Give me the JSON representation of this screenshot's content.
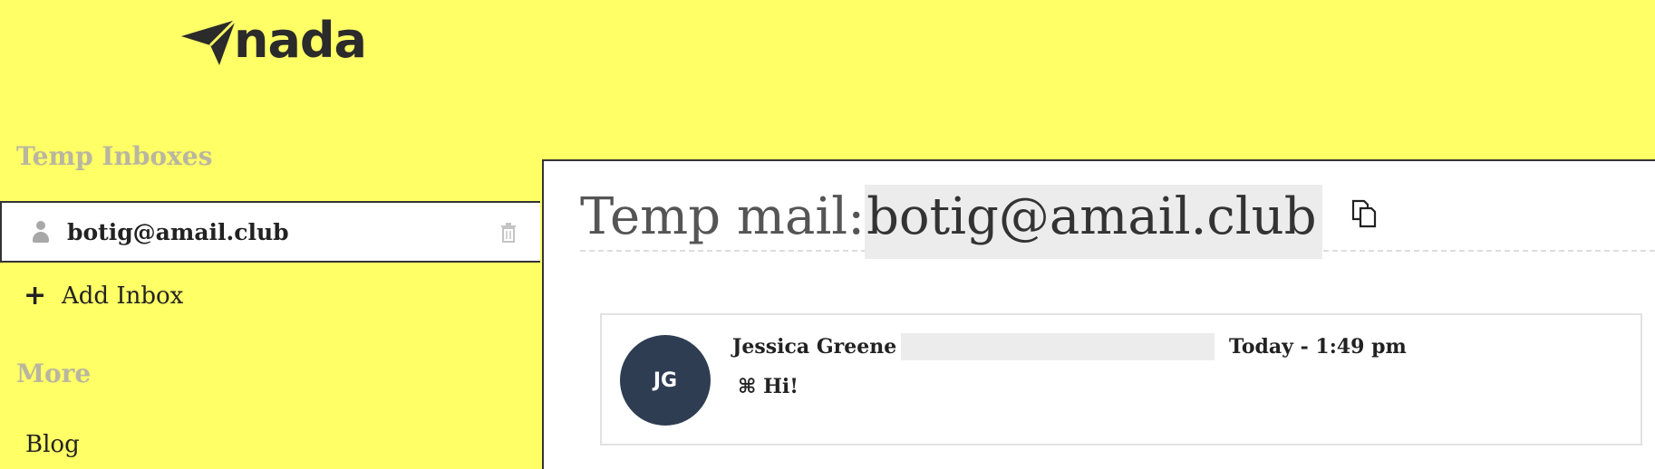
{
  "logo": {
    "text": "nada",
    "icon": "paper-plane-icon"
  },
  "sidebar": {
    "temp_inboxes_title": "Temp Inboxes",
    "inboxes": [
      {
        "address": "botig@amail.club",
        "icon": "user-icon",
        "action_icon": "trash-icon"
      }
    ],
    "add_inbox_label": "Add Inbox",
    "add_inbox_icon": "plus-icon",
    "more_title": "More",
    "more_items": [
      {
        "label": "Blog"
      }
    ]
  },
  "main": {
    "header_prefix": "Temp mail:",
    "header_email": "botig@amail.club",
    "copy_icon": "copy-icon",
    "messages": [
      {
        "avatar_initials": "JG",
        "sender": "Jessica Greene",
        "time": "Today - 1:49 pm",
        "subject": "⌘ Hi!"
      }
    ]
  },
  "colors": {
    "background": "#ffff66",
    "avatar": "#2e3d52",
    "section_title": "#b9b6a0"
  }
}
